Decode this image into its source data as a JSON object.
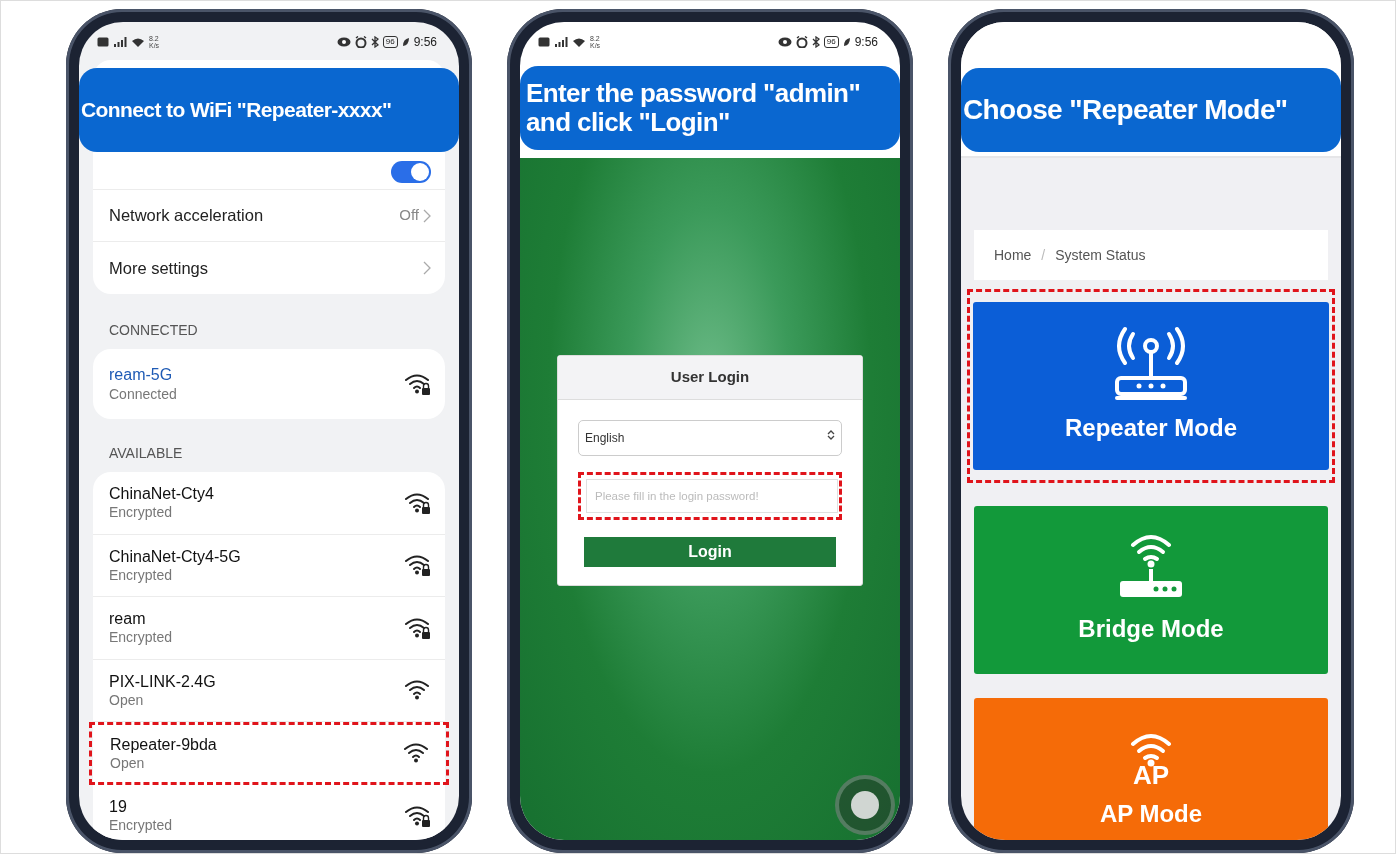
{
  "screens": [
    {
      "kind": "wifi_settings",
      "status_bar": {
        "speed": "8.2",
        "speed_unit": "K/s",
        "battery": "96",
        "time": "9:56"
      },
      "banner": [
        "Connect to WiFi \"Repeater-xxxx\""
      ],
      "wlan": {
        "on": true
      },
      "settings": [
        {
          "label": "Network acceleration",
          "value": "Off"
        },
        {
          "label": "More settings"
        }
      ],
      "connected_header": "CONNECTED",
      "connected": [
        {
          "name": "ream-5G",
          "status": "Connected",
          "locked": true
        }
      ],
      "available_header": "AVAILABLE",
      "available": [
        {
          "name": "ChinaNet-Cty4",
          "status": "Encrypted",
          "locked": true,
          "highlighted": false
        },
        {
          "name": "ChinaNet-Cty4-5G",
          "status": "Encrypted",
          "locked": true,
          "highlighted": false
        },
        {
          "name": "ream",
          "status": "Encrypted",
          "locked": true,
          "highlighted": false
        },
        {
          "name": "PIX-LINK-2.4G",
          "status": "Open",
          "locked": false,
          "highlighted": false
        },
        {
          "name": "Repeater-9bda",
          "status": "Open",
          "locked": false,
          "highlighted": true
        },
        {
          "name": "19",
          "status": "Encrypted",
          "locked": true,
          "highlighted": false
        }
      ]
    },
    {
      "kind": "login",
      "status_bar": {
        "speed": "8.2",
        "speed_unit": "K/s",
        "battery": "96",
        "time": "9:56"
      },
      "banner": [
        "Enter the password \"admin\"",
        "and click \"Login\""
      ],
      "login": {
        "title": "User Login",
        "language": "English",
        "password_placeholder": "Please fill in the login password!",
        "password_highlighted": true,
        "button": "Login"
      }
    },
    {
      "kind": "mode_select",
      "banner": [
        "Choose \"Repeater Mode\""
      ],
      "breadcrumb": {
        "items": [
          {
            "label": "Home"
          },
          {
            "label": "System Status"
          }
        ],
        "separator": "/"
      },
      "modes": [
        {
          "label": "Repeater Mode",
          "kind": "repeater",
          "color": "#0b5ed7",
          "highlighted": true
        },
        {
          "label": "Bridge Mode",
          "kind": "bridge",
          "color": "#12993a",
          "highlighted": false
        },
        {
          "label": "AP Mode",
          "kind": "ap",
          "icon_text": "AP",
          "color": "#f56b08",
          "highlighted": false
        }
      ]
    }
  ]
}
